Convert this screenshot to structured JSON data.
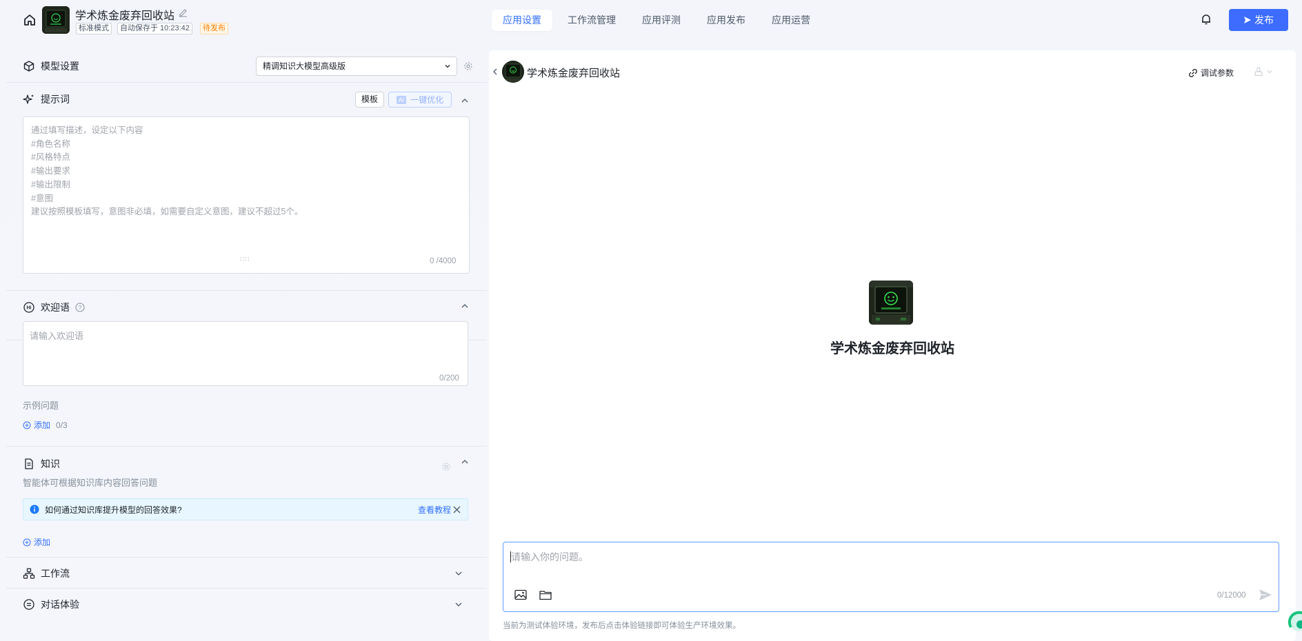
{
  "header": {
    "app_title": "学术炼金废弃回收站",
    "mode_tag": "标准模式",
    "autosave": "自动保存于 10:23:42",
    "status": "待发布",
    "nav": [
      {
        "label": "应用设置",
        "active": true
      },
      {
        "label": "工作流管理",
        "active": false
      },
      {
        "label": "应用评测",
        "active": false
      },
      {
        "label": "应用发布",
        "active": false
      },
      {
        "label": "应用运营",
        "active": false
      }
    ],
    "publish_label": "发布"
  },
  "model": {
    "title": "模型设置",
    "selected": "精调知识大模型高级版"
  },
  "prompt": {
    "title": "提示词",
    "template_btn": "模板",
    "ai_badge": "AI",
    "optimize_btn": "一键优化",
    "placeholder": "通过填写描述，设定以下内容\n#角色名称\n#风格特点\n#输出要求\n#输出限制\n#意图\n建议按照模板填写，意图非必填，如需要自定义意图，建议不超过5个。",
    "counter": "0 /4000"
  },
  "welcome": {
    "title": "欢迎语",
    "placeholder": "请输入欢迎语",
    "counter": "0/200",
    "examples_label": "示例问题",
    "add_label": "添加",
    "add_count": "0/3"
  },
  "knowledge": {
    "title": "知识",
    "desc": "智能体可根据知识库内容回答问题",
    "info_text": "如何通过知识库提升模型的回答效果?",
    "tutorial_link": "查看教程",
    "add_label": "添加"
  },
  "workflow": {
    "title": "工作流"
  },
  "dialog": {
    "title": "对话体验"
  },
  "preview": {
    "title": "学术炼金废弃回收站",
    "debug_params": "调试参数",
    "center_title": "学术炼金废弃回收站",
    "input_placeholder": "请输入你的问题。",
    "counter": "0/12000",
    "env_note": "当前为测试体验环境，发布后点击体验链接即可体验生产环境效果。"
  },
  "colors": {
    "accent": "#3370ff",
    "publish": "#3d6cff",
    "pending": "#ff7d00"
  }
}
